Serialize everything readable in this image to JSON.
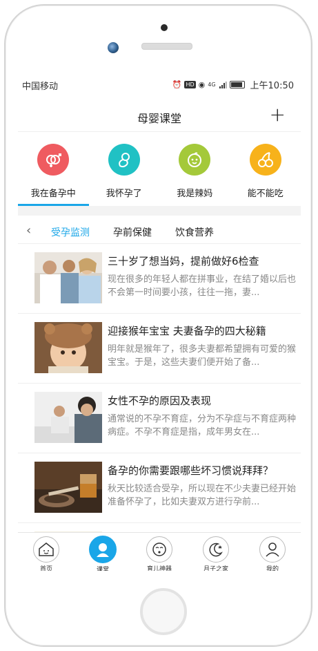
{
  "status": {
    "carrier": "中国移动",
    "time": "上午10:50",
    "hd": "HD",
    "net": "4G"
  },
  "header": {
    "title": "母婴课堂",
    "add_label": "+"
  },
  "categories": [
    {
      "label": "我在备孕中",
      "color": "#ef5b60",
      "icon": "gender-icon",
      "active": true
    },
    {
      "label": "我怀孕了",
      "color": "#20c1c4",
      "icon": "fetus-icon",
      "active": false
    },
    {
      "label": "我是辣妈",
      "color": "#a4c93a",
      "icon": "baby-face-icon",
      "active": false
    },
    {
      "label": "能不能吃",
      "color": "#f7b21b",
      "icon": "cherry-icon",
      "active": false
    }
  ],
  "subtabs": {
    "back_label": "‹",
    "items": [
      {
        "label": "受孕监测",
        "active": true
      },
      {
        "label": "孕前保健",
        "active": false
      },
      {
        "label": "饮食营养",
        "active": false
      }
    ]
  },
  "articles": [
    {
      "title": "三十岁了想当妈，提前做好6检查",
      "desc": "现在很多的年轻人都在拼事业，在结了婚以后也不会第一时间要小孩，往往一拖，妻..."
    },
    {
      "title": "迎接猴年宝宝 夫妻备孕的四大秘籍",
      "desc": "明年就是猴年了，很多夫妻都希望拥有可爱的猴宝宝。于是，这些夫妻们便开始了备..."
    },
    {
      "title": "女性不孕的原因及表现",
      "desc": "通常说的不孕不育症，分为不孕症与不育症两种病症。不孕不育症是指，成年男女在..."
    },
    {
      "title": "备孕的你需要跟哪些坏习惯说拜拜？",
      "desc": "秋天比较适合受孕，所以现在不少夫妻已经开始准备怀孕了，比如夫妻双方进行孕前..."
    }
  ],
  "tabbar": [
    {
      "label": "首页",
      "icon": "house-face-icon",
      "active": false
    },
    {
      "label": "课堂",
      "icon": "user-icon",
      "active": true
    },
    {
      "label": "育儿神器",
      "icon": "baby-face-icon",
      "active": false
    },
    {
      "label": "月子之家",
      "icon": "moon-icon",
      "active": false
    },
    {
      "label": "我的",
      "icon": "person-icon",
      "active": false
    }
  ],
  "colors": {
    "accent": "#1aa6e8",
    "active_tab": "#1aa6e8"
  }
}
